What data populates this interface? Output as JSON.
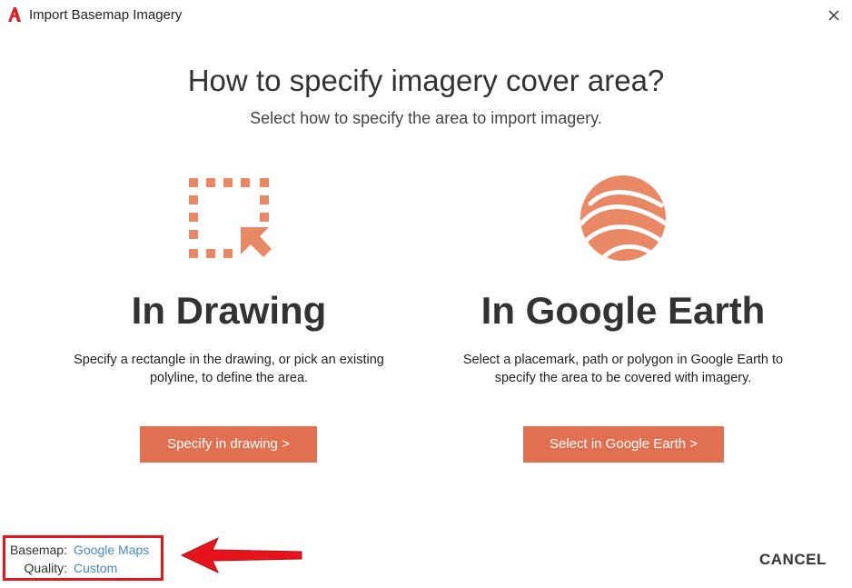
{
  "window": {
    "title": "Import Basemap Imagery",
    "app_icon": "autocad-logo-icon",
    "close_icon": "close-icon"
  },
  "header": {
    "title": "How to specify imagery cover area?",
    "subtitle": "Select how to specify the area to import imagery."
  },
  "options": [
    {
      "icon": "dashed-rectangle-pointer-icon",
      "title": "In Drawing",
      "description": "Specify a rectangle in the drawing, or pick an existing polyline, to define the area.",
      "button_label": "Specify in drawing >"
    },
    {
      "icon": "globe-icon",
      "title": "In Google Earth",
      "description": "Select a placemark, path or polygon in Google Earth to specify the area to be covered with imagery.",
      "button_label": "Select in Google Earth >"
    }
  ],
  "footer": {
    "basemap_label": "Basemap:",
    "basemap_value": "Google Maps",
    "quality_label": "Quality:",
    "quality_value": "Custom",
    "cancel_label": "CANCEL"
  },
  "colors": {
    "accent": "#e07050",
    "link": "#4a86c5",
    "highlight_box": "#e8141c"
  }
}
